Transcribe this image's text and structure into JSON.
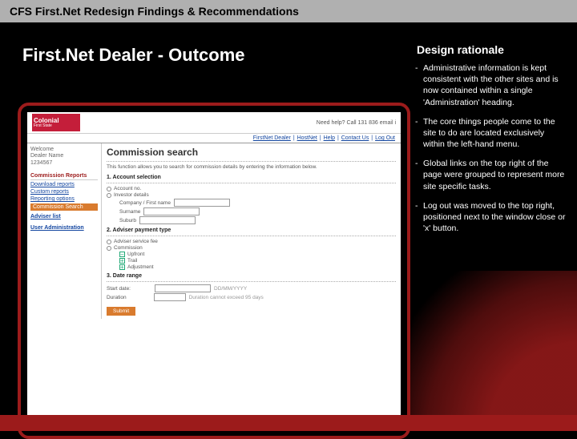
{
  "header": {
    "title": "CFS First.Net Redesign Findings & Recommendations"
  },
  "main": {
    "title": "First.Net Dealer - Outcome"
  },
  "mock": {
    "logo_main": "Colonial",
    "logo_sub": "First State",
    "help_text": "Need help? Call 131 836 email i",
    "nav": {
      "dealer": "FirstNet Dealer",
      "hostnet": "HostNet",
      "help": "Help",
      "contact": "Contact Us",
      "logout": "Log Out"
    },
    "welcome": {
      "label": "Welcome",
      "name": "Dealer Name",
      "id": "1234567"
    },
    "sidebar": {
      "section1": "Commission Reports",
      "items1": [
        "Download reports",
        "Custom reports",
        "Reporting options"
      ],
      "active_item": "Commission Search",
      "section2_link": "Adviser list",
      "section3_link": "User Administration"
    },
    "content": {
      "heading": "Commission search",
      "desc": "This function allows you to search for commission details by entering the information below.",
      "step1": "1. Account selection",
      "acct_no": "Account no.",
      "investor": "Investor details",
      "company": "Company / First name",
      "surname": "Surname",
      "suburb": "Suburb",
      "step2": "2. Adviser payment type",
      "service_fee": "Adviser service fee",
      "commission": "Commission",
      "upfront": "Upfront",
      "trail": "Trail",
      "adjustment": "Adjustment",
      "step3": "3. Date range",
      "start_date": "Start date:",
      "date_placeholder": "DD/MM/YYYY",
      "duration": "Duration",
      "duration_note": "Duration cannot exceed 95 days",
      "submit": "Submit"
    }
  },
  "rationale": {
    "title": "Design rationale",
    "points": [
      "Administrative information is kept consistent with the other sites and is now contained within a single 'Administration' heading.",
      "The core things people come to the site to do are located exclusively within the left-hand menu.",
      "Global links on the top right of the page were grouped to represent more site specific tasks.",
      "Log out was moved to the top right, positioned next to the window close or 'x' button."
    ]
  }
}
